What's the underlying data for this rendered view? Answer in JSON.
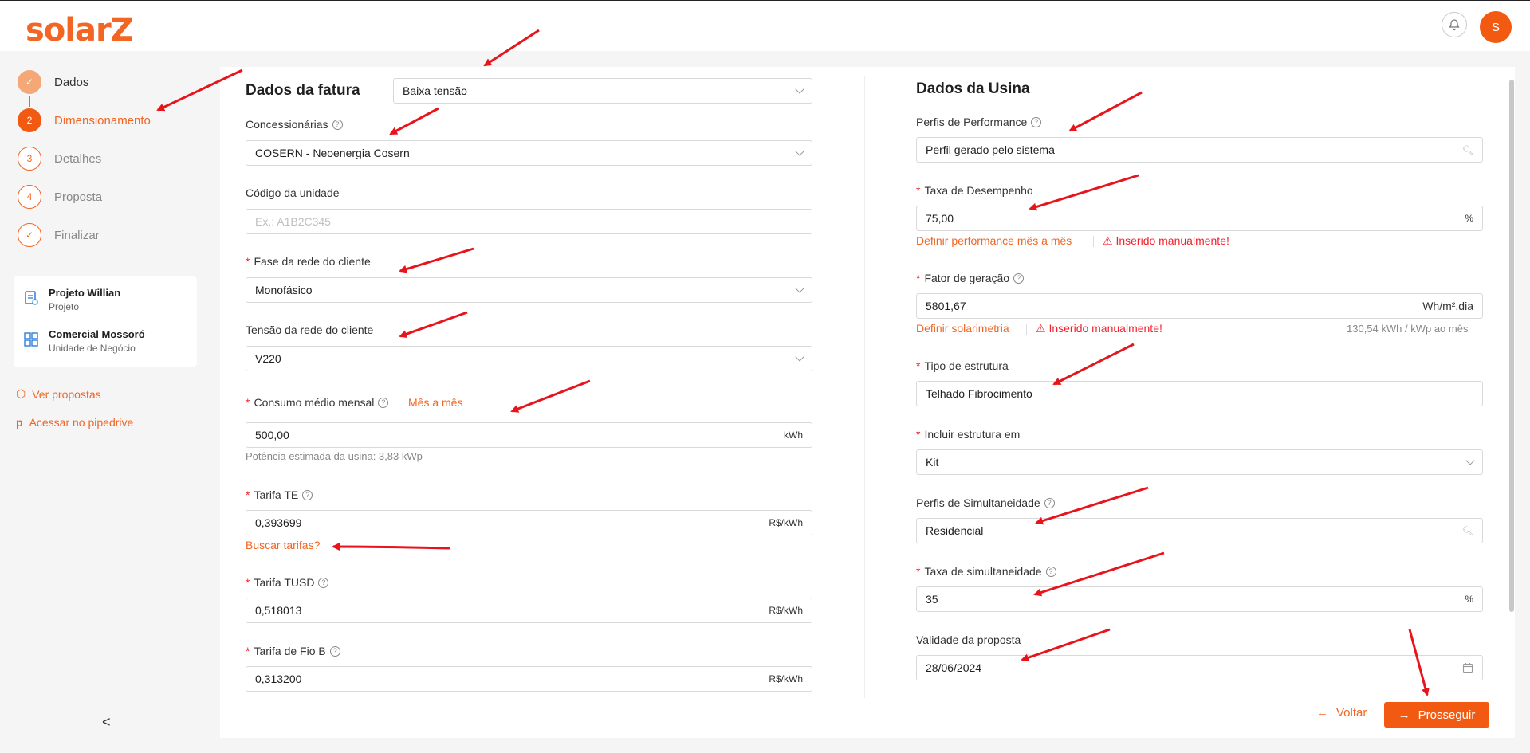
{
  "header": {
    "logo": "solarZ",
    "avatar_initial": "S"
  },
  "steps": [
    {
      "num": "✓",
      "label": "Dados",
      "state": "done"
    },
    {
      "num": "2",
      "label": "Dimensionamento",
      "state": "active"
    },
    {
      "num": "3",
      "label": "Detalhes",
      "state": "todo"
    },
    {
      "num": "4",
      "label": "Proposta",
      "state": "todo"
    },
    {
      "num": "✓",
      "label": "Finalizar",
      "state": "todo"
    }
  ],
  "project": {
    "name": "Projeto Willian",
    "name_sub": "Projeto",
    "unit": "Comercial Mossoró",
    "unit_sub": "Unidade de Negócio"
  },
  "links": {
    "ver_propostas": "Ver propostas",
    "pipedrive": "Acessar no pipedrive"
  },
  "left": {
    "title": "Dados da fatura",
    "tensao": "Baixa tensão",
    "concessionarias_label": "Concessionárias",
    "concessionarias_value": "COSERN - Neoenergia Cosern",
    "codigo_label": "Código da unidade",
    "codigo_placeholder": "Ex.: A1B2C345",
    "fase_label": "Fase da rede do cliente",
    "fase_value": "Monofásico",
    "tensao_rede_label": "Tensão da rede do cliente",
    "tensao_rede_value": "V220",
    "consumo_label": "Consumo médio mensal",
    "consumo_link": "Mês a mês",
    "consumo_value": "500,00",
    "consumo_unit": "kWh",
    "potencia_hint": "Potência estimada da usina: 3,83 kWp",
    "te_label": "Tarifa TE",
    "te_value": "0,393699",
    "te_unit": "R$/kWh",
    "buscar_tarifas": "Buscar tarifas?",
    "tusd_label": "Tarifa TUSD",
    "tusd_value": "0,518013",
    "tusd_unit": "R$/kWh",
    "fiob_label": "Tarifa de Fio B",
    "fiob_value": "0,313200",
    "fiob_unit": "R$/kWh"
  },
  "right": {
    "title": "Dados da Usina",
    "perfis_perf_label": "Perfis de Performance",
    "perfis_perf_value": "Perfil gerado pelo sistema",
    "taxa_desemp_label": "Taxa de Desempenho",
    "taxa_desemp_value": "75,00",
    "taxa_desemp_unit": "%",
    "definir_perf": "Definir performance mês a mês",
    "inserido_1": "Inserido manualmente!",
    "fator_label": "Fator de geração",
    "fator_value": "5801,67",
    "fator_unit": "Wh/m².dia",
    "definir_solar": "Definir solarimetria",
    "inserido_2": "Inserido manualmente!",
    "kwh_hint": "130,54 kWh / kWp ao mês",
    "tipo_label": "Tipo de estrutura",
    "tipo_value": "Telhado Fibrocimento",
    "incluir_label": "Incluir estrutura em",
    "incluir_value": "Kit",
    "perfis_sim_label": "Perfis de Simultaneidade",
    "perfis_sim_value": "Residencial",
    "taxa_sim_label": "Taxa de simultaneidade",
    "taxa_sim_value": "35",
    "taxa_sim_unit": "%",
    "validade_label": "Validade da proposta",
    "validade_value": "28/06/2024"
  },
  "actions": {
    "voltar": "Voltar",
    "prosseguir": "Prosseguir"
  },
  "colors": {
    "accent": "#f25a12",
    "error": "#f5222d",
    "annotation": "#e8141c"
  }
}
